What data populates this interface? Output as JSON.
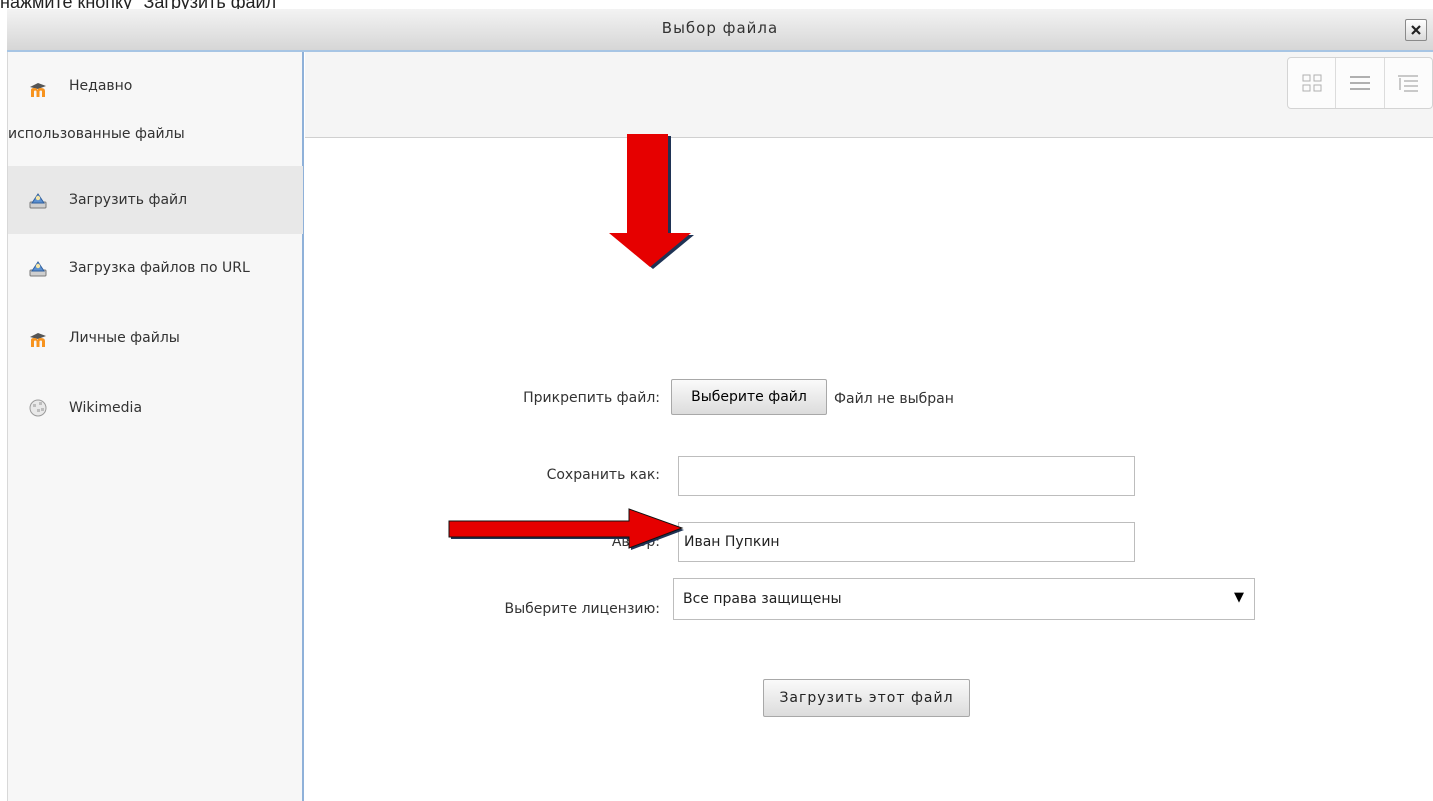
{
  "caption": "нажмите кнопку \"Загрузить файл\"",
  "dialog": {
    "title": "Выбор файла",
    "close_label": "X"
  },
  "sidebar": {
    "items": [
      {
        "label_line1": "Недавно",
        "label_line2": "использованные файлы",
        "icon": "moodle-icon"
      },
      {
        "label": "Загрузить файл",
        "icon": "upload-icon",
        "active": true
      },
      {
        "label": "Загрузка файлов по URL",
        "icon": "url-download-icon"
      },
      {
        "label": "Личные файлы",
        "icon": "moodle-icon"
      },
      {
        "label": "Wikimedia",
        "icon": "wikimedia-globe-icon"
      }
    ]
  },
  "toolbar": {
    "view_modes": [
      "icons-view-icon",
      "list-view-icon",
      "tree-view-icon"
    ]
  },
  "form": {
    "attach_label": "Прикрепить файл:",
    "choose_button": "Выберите файл",
    "no_file": "Файл не выбран",
    "save_as_label": "Сохранить как:",
    "save_as_value": "",
    "author_label": "Автор:",
    "author_value": "Иван Пупкин",
    "license_label": "Выберите лицензию:",
    "license_value": "Все права защищены",
    "upload_button": "Загрузить этот файл"
  },
  "annotations": {
    "arrow_color": "#e60000",
    "arrow_outline": "#1f3355"
  }
}
